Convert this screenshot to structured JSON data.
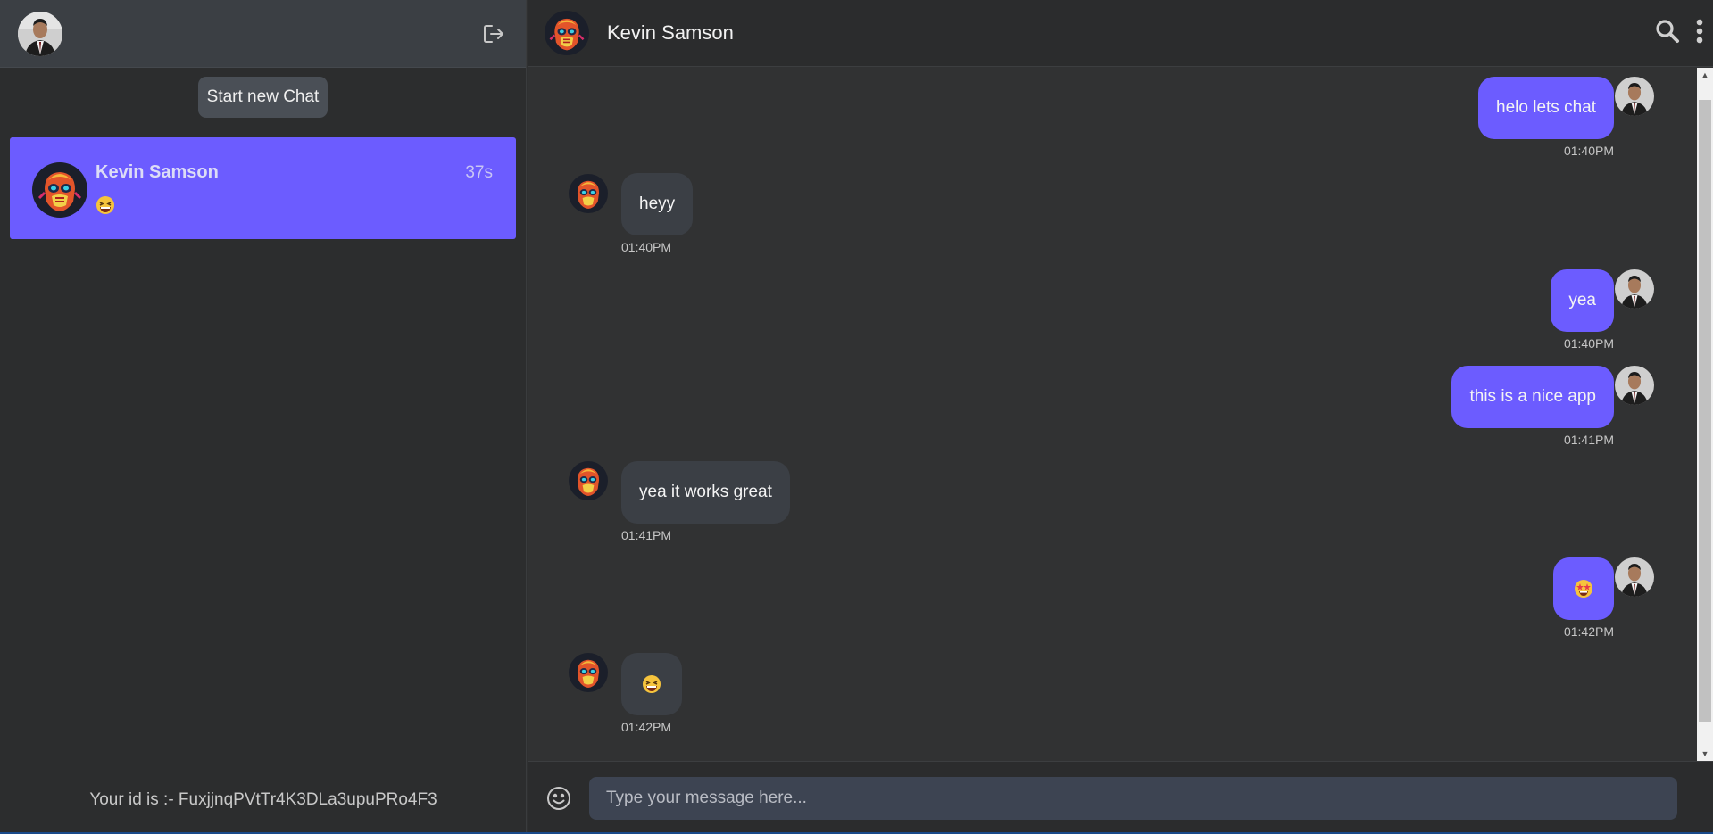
{
  "sidebar": {
    "new_chat_label": "Start new Chat",
    "chats": [
      {
        "name": "Kevin Samson",
        "time": "37s",
        "preview_icon": "grinning-squint-emoji"
      }
    ],
    "user_id_text": "Your id is :- FuxjjnqPVtTr4K3DLa3upuPRo4F3"
  },
  "header": {
    "contact_name": "Kevin Samson"
  },
  "messages": [
    {
      "from": "me",
      "text": "helo lets chat",
      "time": "01:40PM"
    },
    {
      "from": "them",
      "text": "heyy",
      "time": "01:40PM"
    },
    {
      "from": "me",
      "text": "yea",
      "time": "01:40PM"
    },
    {
      "from": "me",
      "text": "this is a nice app",
      "time": "01:41PM"
    },
    {
      "from": "them",
      "text": "yea it works great",
      "time": "01:41PM"
    },
    {
      "from": "me",
      "text": "",
      "emoji": "star-struck-emoji",
      "time": "01:42PM"
    },
    {
      "from": "them",
      "text": "",
      "emoji": "grinning-squint-emoji",
      "time": "01:42PM"
    }
  ],
  "composer": {
    "placeholder": "Type your message here..."
  },
  "colors": {
    "accent": "#6c5cff",
    "sidebar_bg": "#2c2d2e",
    "main_bg": "#313233",
    "received_bubble": "#3b3f45"
  }
}
